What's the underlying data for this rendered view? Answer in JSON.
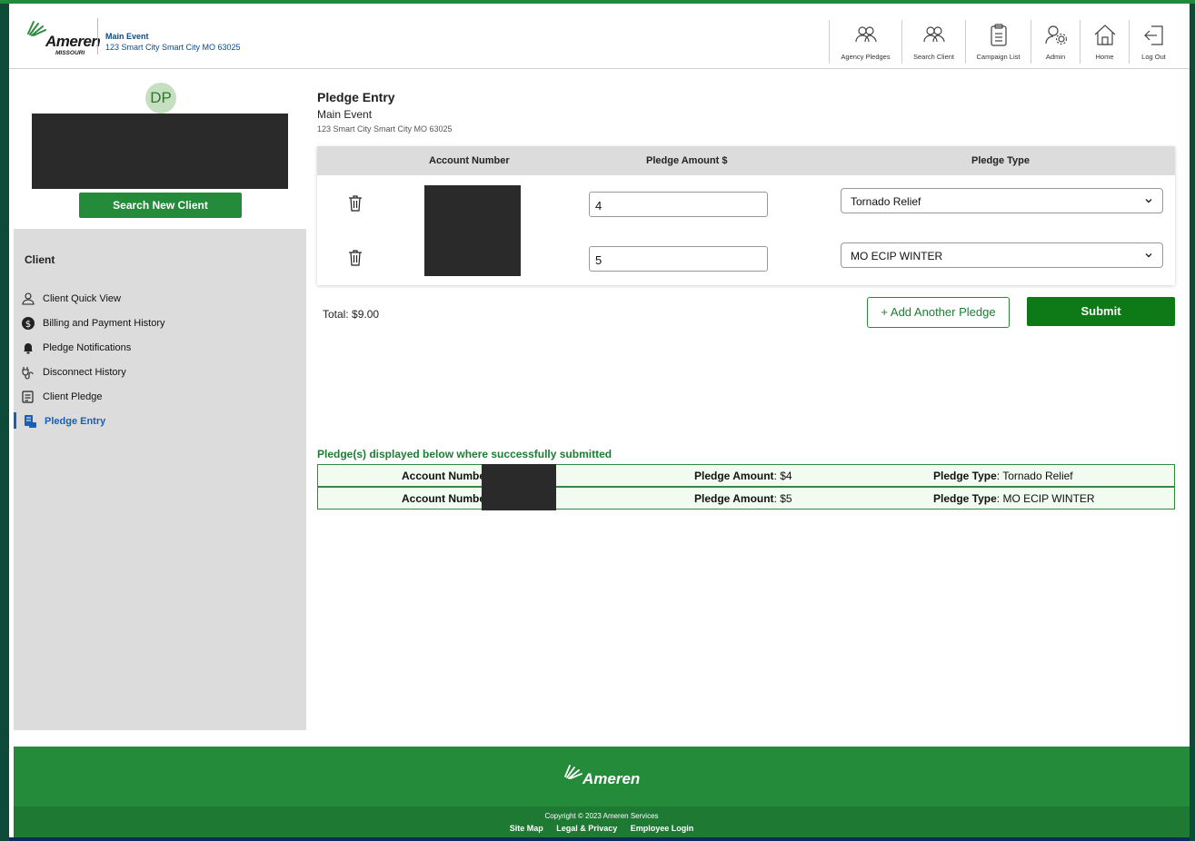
{
  "header": {
    "logo_word": "Ameren",
    "logo_sub": "MISSOURI",
    "event_name": "Main Event",
    "event_address": "123 Smart City Smart City MO 63025",
    "nav": [
      {
        "label": "Agency Pledges",
        "icon": "users-icon"
      },
      {
        "label": "Search Client",
        "icon": "users-search-icon"
      },
      {
        "label": "Campaign List",
        "icon": "clipboard-icon"
      },
      {
        "label": "Admin",
        "icon": "user-gear-icon"
      },
      {
        "label": "Home",
        "icon": "home-icon"
      },
      {
        "label": "Log Out",
        "icon": "logout-icon"
      }
    ]
  },
  "sidebar": {
    "avatar_initials": "DP",
    "search_new_client": "Search New Client",
    "section_title": "Client",
    "items": [
      {
        "label": "Client Quick View",
        "icon": "person-icon"
      },
      {
        "label": "Billing and Payment History",
        "icon": "dollar-circle-icon"
      },
      {
        "label": "Pledge Notifications",
        "icon": "bell-icon"
      },
      {
        "label": "Disconnect History",
        "icon": "plug-icon"
      },
      {
        "label": "Client Pledge",
        "icon": "document-icon"
      },
      {
        "label": "Pledge Entry",
        "icon": "pledge-entry-icon",
        "active": true
      }
    ]
  },
  "main": {
    "title": "Pledge Entry",
    "event_name": "Main Event",
    "event_address": "123 Smart City Smart City MO 63025",
    "columns": [
      "Account Number",
      "Pledge Amount $",
      "Pledge Type"
    ],
    "rows": [
      {
        "amount": "4",
        "type": "Tornado Relief"
      },
      {
        "amount": "5",
        "type": "MO ECIP WINTER"
      }
    ],
    "total": "Total: $9.00",
    "add_button": "+ Add Another Pledge",
    "submit_button": "Submit",
    "success_message": "Pledge(s) displayed below where successfully submitted",
    "submitted": [
      {
        "acct_label": "Account Number:",
        "amount_label": "Pledge Amount",
        "amount": ": $4",
        "type_label": "Pledge Type",
        "type": ": Tornado Relief"
      },
      {
        "acct_label": "Account Number:",
        "amount_label": "Pledge Amount",
        "amount": ": $5",
        "type_label": "Pledge Type",
        "type": ": MO ECIP WINTER"
      }
    ]
  },
  "footer": {
    "logo_word": "Ameren",
    "copyright": "Copyright © 2023 Ameren Services",
    "links": [
      "Site Map",
      "Legal & Privacy",
      "Employee Login"
    ]
  },
  "colors": {
    "brand_green": "#238b3a",
    "submit_green": "#0e7a17",
    "link_blue": "#1a5fb4",
    "frame_navy": "#0a2d5c"
  }
}
